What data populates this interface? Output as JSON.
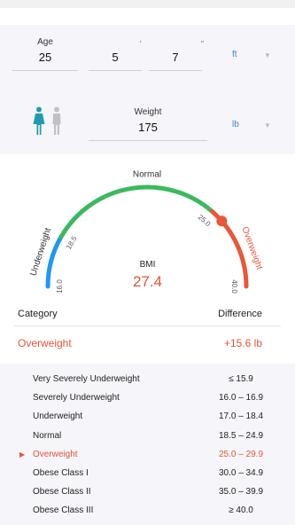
{
  "inputs": {
    "age": {
      "label": "Age",
      "value": "25"
    },
    "height": {
      "feet": "5",
      "inches": "7",
      "feet_mark": "'",
      "inches_mark": "\"",
      "unit": "ft"
    },
    "weight": {
      "label": "Weight",
      "value": "175",
      "unit": "lb"
    }
  },
  "gauge": {
    "min": 16.0,
    "max": 40.0,
    "value": 27.4,
    "labels": {
      "underweight": "Underweight",
      "normal": "Normal",
      "overweight": "Overweight"
    },
    "ticks": [
      "16.0",
      "18.5",
      "25.0",
      "40.0"
    ],
    "colors": {
      "underweight": "#2196f3",
      "normal": "#3cb95f",
      "overweight": "#ea5638"
    }
  },
  "bmi": {
    "label": "BMI",
    "value": "27.4"
  },
  "summary": {
    "category_header": "Category",
    "difference_header": "Difference",
    "category": "Overweight",
    "difference": "+15.6 lb"
  },
  "table": [
    {
      "category": "Very Severely Underweight",
      "range": "≤ 15.9"
    },
    {
      "category": "Severely Underweight",
      "range": "16.0 – 16.9"
    },
    {
      "category": "Underweight",
      "range": "17.0 – 18.4"
    },
    {
      "category": "Normal",
      "range": "18.5 – 24.9"
    },
    {
      "category": "Overweight",
      "range": "25.0 – 29.9"
    },
    {
      "category": "Obese Class I",
      "range": "30.0 – 34.9"
    },
    {
      "category": "Obese Class II",
      "range": "35.0 – 39.9"
    },
    {
      "category": "Obese Class III",
      "range": "≥ 40.0"
    }
  ],
  "active_row_index": 4,
  "icons": {
    "female": "female-figure-icon",
    "male": "male-figure-icon",
    "dropdown": "chevron-down-icon",
    "selected": "triangle-right-icon"
  }
}
